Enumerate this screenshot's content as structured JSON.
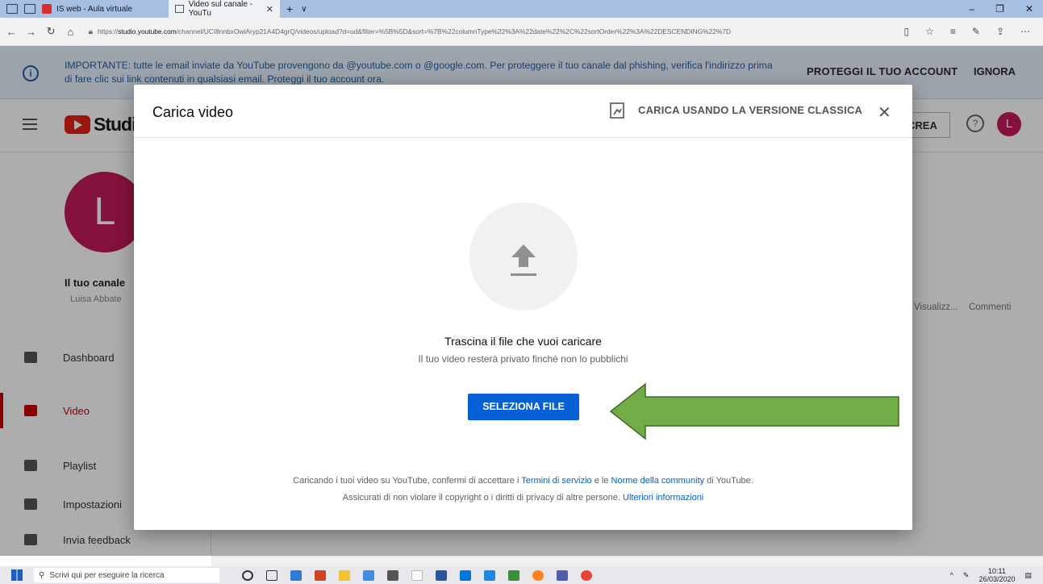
{
  "browser": {
    "tabs": [
      {
        "label": "IS web - Aula virtuale"
      },
      {
        "label": "Video sul canale - YouTu"
      }
    ],
    "url_prefix": "https://",
    "url_domain": "studio.youtube.com",
    "url_path": "/channel/UCI8nnbxOwiAryp21A4D4grQ/videos/upload?d=ud&filter=%5B%5D&sort=%7B%22columnType%22%3A%22date%22%2C%22sortOrder%22%3A%22DESCENDING%22%7D"
  },
  "banner": {
    "message": "IMPORTANTE: tutte le email inviate da YouTube provengono da @youtube.com o @google.com. Per proteggere il tuo canale dal phishing, verifica l'indirizzo prima di fare clic sui link contenuti in qualsiasi email. Proteggi il tuo account ora.",
    "protect_label": "PROTEGGI IL TUO ACCOUNT",
    "ignore_label": "IGNORA"
  },
  "studio": {
    "logo_text": "Studio",
    "create_label": "CREA",
    "avatar_letter": "L",
    "channel_title": "Il tuo canale",
    "channel_owner": "Luisa Abbate",
    "columns": {
      "views": "Visualizz...",
      "comments": "Commenti"
    },
    "sidebar": [
      {
        "label": "Dashboard"
      },
      {
        "label": "Video"
      },
      {
        "label": "Playlist"
      },
      {
        "label": "Impostazioni"
      },
      {
        "label": "Invia feedback"
      }
    ]
  },
  "modal": {
    "title": "Carica video",
    "classic_label": "CARICA USANDO LA VERSIONE CLASSICA",
    "drop_title": "Trascina il file che vuoi caricare",
    "drop_subtitle": "Il tuo video resterà privato finché non lo pubblichi",
    "select_label": "SELEZIONA FILE",
    "legal": {
      "line1_a": "Caricando i tuoi video su YouTube, confermi di accettare i ",
      "terms": "Termini di servizio",
      "line1_b": " e le ",
      "community": "Norme della community",
      "line1_c": " di YouTube.",
      "line2_a": "Assicurati di non violare il copyright o i diritti di privacy di altre persone. ",
      "more_info": "Ulteriori informazioni"
    }
  },
  "taskbar": {
    "search_placeholder": "Scrivi qui per eseguire la ricerca",
    "time": "10:11",
    "date": "26/03/2020"
  },
  "colors": {
    "accent_blue": "#065fd4",
    "youtube_red": "#e62117",
    "avatar": "#c2185b",
    "arrow_green": "#70ad47"
  }
}
